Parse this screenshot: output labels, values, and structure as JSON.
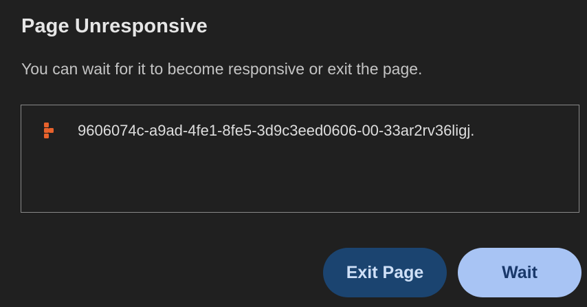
{
  "dialog": {
    "title": "Page Unresponsive",
    "message": "You can wait for it to become responsive or exit the page."
  },
  "pages": [
    {
      "name": "9606074c-a9ad-4fe1-8fe5-3d9c3eed0606-00-33ar2rv36ligj.",
      "icon": "replit-logo-icon"
    }
  ],
  "buttons": {
    "exit_label": "Exit Page",
    "wait_label": "Wait"
  },
  "colors": {
    "background": "#202020",
    "exit_button_bg": "#1b4470",
    "wait_button_bg": "#a8c4f4",
    "icon_accent": "#e8622c"
  }
}
